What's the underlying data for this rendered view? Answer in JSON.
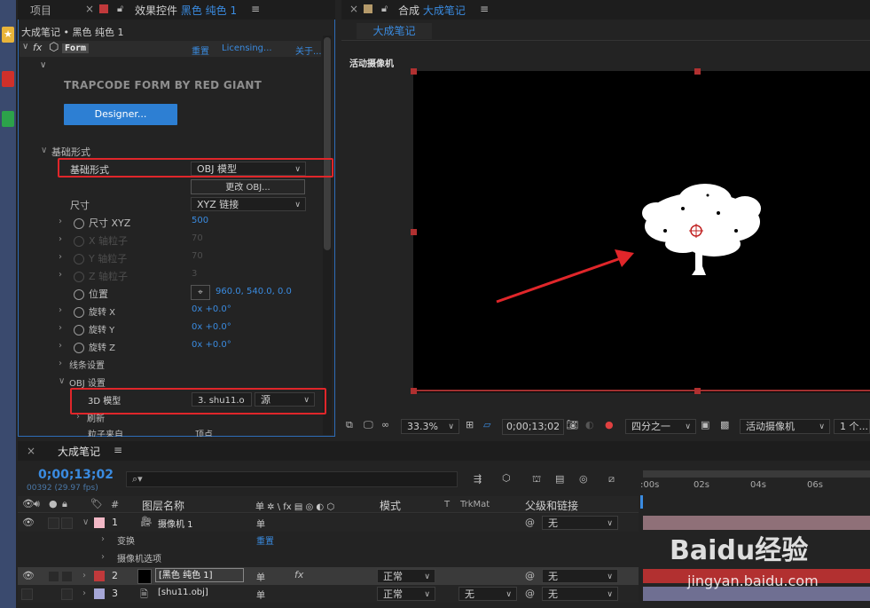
{
  "left_tabs": {
    "project": "项目",
    "effects_prefix": "效果控件",
    "effects_layer": "黑色 纯色 1",
    "menu": "≡"
  },
  "breadcrumb": "大成笔记 • 黑色 纯色 1",
  "effect": {
    "fx": "fx",
    "name": "Form",
    "reset": "重置",
    "licensing": "Licensing...",
    "about": "关于..."
  },
  "brand": "TRAPCODE FORM BY RED GIANT",
  "designer_button": "Designer...",
  "props": {
    "base_form_group": "基础形式",
    "base_form_label": "基础形式",
    "base_form_value": "OBJ 模型",
    "change_obj": "更改 OBJ...",
    "size_label": "尺寸",
    "size_value": "XYZ 链接",
    "size_xyz_label": "尺寸 XYZ",
    "size_xyz_value": "500",
    "x_particles_label": "X 轴粒子",
    "x_particles_value": "70",
    "y_particles_label": "Y 轴粒子",
    "y_particles_value": "70",
    "z_particles_label": "Z 轴粒子",
    "z_particles_value": "3",
    "position_label": "位置",
    "position_value": "960.0, 540.0, 0.0",
    "rot_x_label": "旋转 X",
    "rot_x_value": "0x +0.0°",
    "rot_y_label": "旋转 Y",
    "rot_y_value": "0x +0.0°",
    "rot_z_label": "旋转 Z",
    "rot_z_value": "0x +0.0°",
    "string_settings": "线条设置",
    "obj_settings": "OBJ 设置",
    "model_3d_label": "3D 模型",
    "model_3d_value": "3. shu11.o",
    "model_3d_source": "源",
    "refresh": "刷新",
    "particles_from": "粒子来自",
    "particles_from_value": "顶点"
  },
  "comp_tabs": {
    "comp_prefix": "合成",
    "comp_name": "大成笔记",
    "menu": "≡",
    "subtab": "大成笔记"
  },
  "viewer": {
    "camera_label": "活动摄像机"
  },
  "viewer_bar": {
    "zoom": "33.3%",
    "timecode": "0;00;13;02",
    "resolution": "四分之一",
    "camera": "活动摄像机",
    "views": "1 个..."
  },
  "timeline": {
    "tab": "大成笔记",
    "menu": "≡",
    "timecode": "0;00;13;02",
    "frames": "00392 (29.97 fps)",
    "search_placeholder": "",
    "ruler": [
      ":00s",
      "02s",
      "04s",
      "06s"
    ],
    "headers": {
      "num": "#",
      "layer_name": "图层名称",
      "switches": "单 ✲ \\ fx ▤ ◎ ◐ ⬡",
      "mode": "模式",
      "t": "T",
      "trkmat": "TrkMat",
      "parent": "父级和链接"
    },
    "layers": [
      {
        "num": "1",
        "name": "摄像机 1",
        "switch": "单",
        "parent": "无"
      },
      {
        "num": "2",
        "name": "[黑色 纯色 1]",
        "switch": "单",
        "mode": "正常",
        "parent": "无"
      },
      {
        "num": "3",
        "name": "[shu11.obj]",
        "switch": "单",
        "mode": "正常",
        "trkmat": "无",
        "parent": "无"
      }
    ],
    "transform": "变换",
    "transform_reset": "重置",
    "camera_options": "摄像机选项"
  },
  "colors": {
    "accent": "#3a8be0",
    "highlight_red": "#e0262a",
    "camera_label": "#f2b8c6",
    "solid_label": "#c0393b",
    "obj_label": "#a5a6d6"
  },
  "watermark": {
    "text": "Baidu经验",
    "url": "jingyan.baidu.com"
  }
}
